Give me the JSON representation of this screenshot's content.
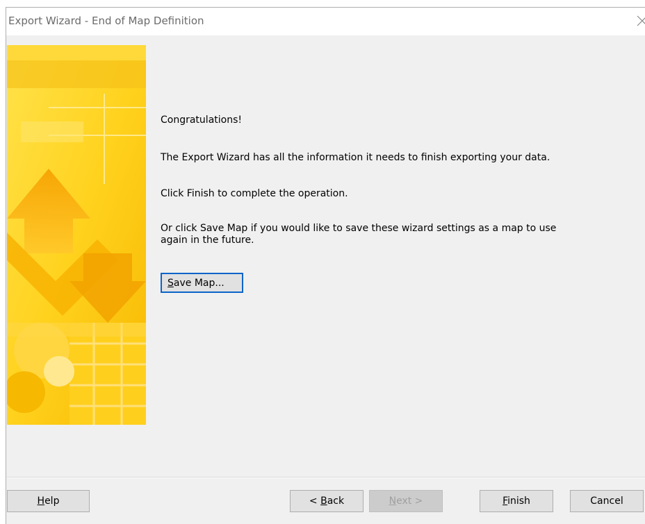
{
  "window": {
    "title": "Export Wizard - End of Map Definition"
  },
  "content": {
    "heading": "Congratulations!",
    "line1": "The Export Wizard has all the information it needs to finish exporting your data.",
    "line2": "Click Finish to complete the operation.",
    "line3a": "Or click Save Map if you would like to save these wizard settings as a map to use",
    "line3b": "again in the future."
  },
  "buttons": {
    "save_map": {
      "mnemonic": "S",
      "rest": "ave Map..."
    },
    "help": {
      "mnemonic": "H",
      "rest": "elp"
    },
    "back": {
      "prefix": "< ",
      "mnemonic": "B",
      "rest": "ack"
    },
    "next": {
      "mnemonic": "N",
      "rest": "ext >"
    },
    "finish": {
      "mnemonic": "F",
      "rest": "inish"
    },
    "cancel": {
      "label": "Cancel"
    }
  },
  "colors": {
    "focus_border": "#0a64c8",
    "banner_yellow": "#ffd21e",
    "banner_orange": "#f5a000"
  },
  "icons": {
    "close": "close-icon",
    "banner": "wizard-banner-art"
  }
}
